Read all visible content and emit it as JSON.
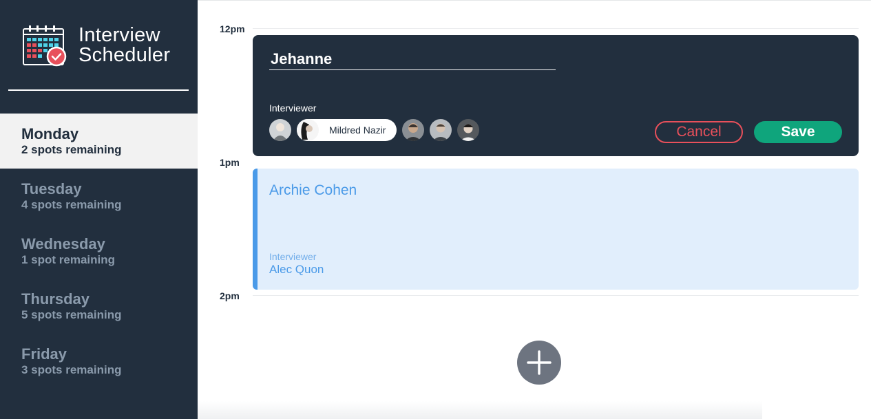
{
  "brand": {
    "line1": "Interview",
    "line2": "Scheduler"
  },
  "days": [
    {
      "name": "Monday",
      "spots": "2 spots remaining",
      "selected": true
    },
    {
      "name": "Tuesday",
      "spots": "4 spots remaining",
      "selected": false
    },
    {
      "name": "Wednesday",
      "spots": "1 spot remaining",
      "selected": false
    },
    {
      "name": "Thursday",
      "spots": "5 spots remaining",
      "selected": false
    },
    {
      "name": "Friday",
      "spots": "3 spots remaining",
      "selected": false
    }
  ],
  "times": [
    "12pm",
    "1pm",
    "2pm"
  ],
  "form": {
    "student_name": "Jehanne",
    "interviewer_label": "Interviewer",
    "selected_interviewer": "Mildred Nazir",
    "cancel_label": "Cancel",
    "save_label": "Save"
  },
  "appointment": {
    "student": "Archie Cohen",
    "interviewer_label": "Interviewer",
    "interviewer": "Alec Quon"
  },
  "add_button_icon": "plus-icon",
  "colors": {
    "sidebar": "#222f3e",
    "accent_blue": "#4a9ae8",
    "save_green": "#0fa57c",
    "cancel_red": "#e8505b"
  }
}
